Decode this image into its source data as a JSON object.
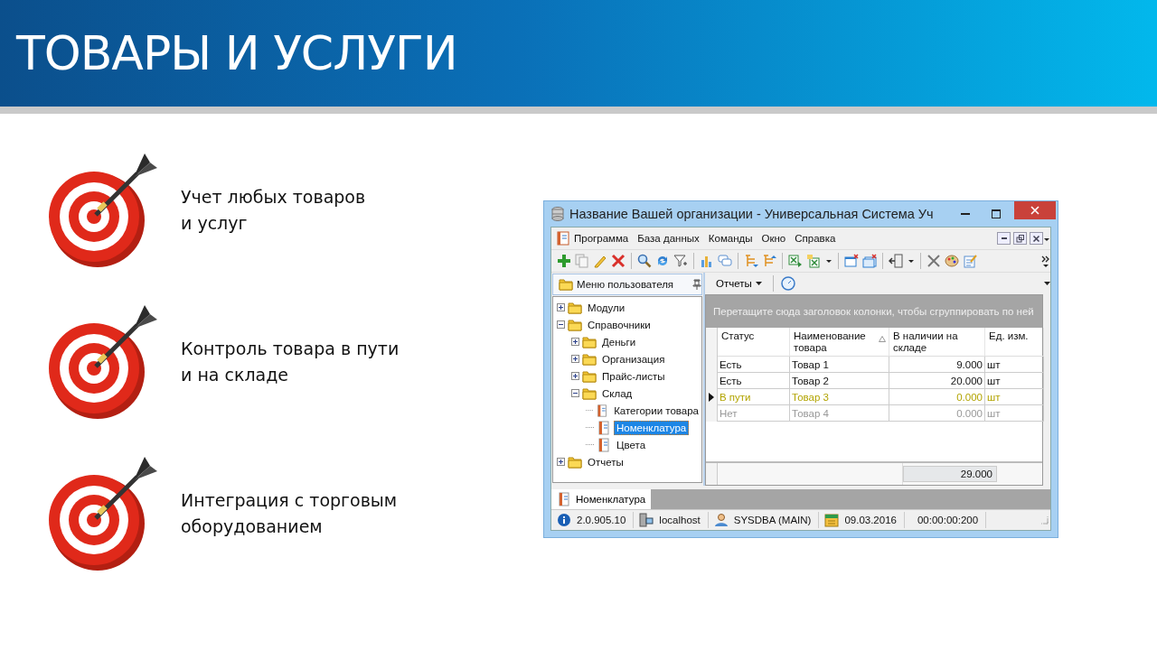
{
  "slide": {
    "title": "ТОВАРЫ И УСЛУГИ",
    "features": [
      {
        "text": "Учет любых товаров\nи услуг"
      },
      {
        "text": "Контроль товара в пути\nи на складе"
      },
      {
        "text": "Интеграция с торговым\nоборудованием"
      }
    ]
  },
  "window": {
    "title": "Название Вашей организации - Универсальная Система Уч",
    "menu": [
      "Программа",
      "База данных",
      "Команды",
      "Окно",
      "Справка"
    ],
    "nav_panel": {
      "title": "Меню пользователя",
      "tree": [
        {
          "label": "Модули",
          "kind": "folder",
          "expanded": false,
          "selected": false
        },
        {
          "label": "Справочники",
          "kind": "folder",
          "expanded": true,
          "selected": false,
          "children": [
            {
              "label": "Деньги",
              "kind": "folder",
              "expanded": false,
              "selected": false
            },
            {
              "label": "Организация",
              "kind": "folder",
              "expanded": false,
              "selected": false
            },
            {
              "label": "Прайс-листы",
              "kind": "folder",
              "expanded": false,
              "selected": false
            },
            {
              "label": "Склад",
              "kind": "folder",
              "expanded": true,
              "selected": false,
              "children": [
                {
                  "label": "Категории товара",
                  "kind": "document",
                  "selected": false
                },
                {
                  "label": "Номенклатура",
                  "kind": "document",
                  "selected": true
                },
                {
                  "label": "Цвета",
                  "kind": "document",
                  "selected": false
                }
              ]
            }
          ]
        },
        {
          "label": "Отчеты",
          "kind": "folder",
          "expanded": false,
          "selected": false
        }
      ]
    },
    "reports_button": "Отчеты",
    "grid": {
      "group_hint": "Перетащите сюда заголовок колонки, чтобы сгруппировать по ней",
      "columns": [
        {
          "label": "Статус",
          "sorted": false
        },
        {
          "label": "Наименование товара",
          "sorted": true
        },
        {
          "label": "В наличии на складе",
          "sorted": false
        },
        {
          "label": "Ед. изм.",
          "sorted": false
        }
      ],
      "rows": [
        {
          "kind": "in_stock",
          "selected": false,
          "cells": [
            "Есть",
            "Товар 1",
            "9.000",
            "шт"
          ]
        },
        {
          "kind": "in_stock",
          "selected": false,
          "cells": [
            "Есть",
            "Товар 2",
            "20.000",
            "шт"
          ]
        },
        {
          "kind": "in_transit",
          "selected": true,
          "cells": [
            "В пути",
            "Товар 3",
            "0.000",
            "шт"
          ]
        },
        {
          "kind": "absent",
          "selected": false,
          "cells": [
            "Нет",
            "Товар 4",
            "0.000",
            "шт"
          ]
        }
      ],
      "total": "29.000"
    },
    "tabs": [
      {
        "label": "Номенклатура",
        "selected": true
      }
    ],
    "status_bar": [
      {
        "kind": "version",
        "text": "2.0.905.10"
      },
      {
        "kind": "server",
        "text": "localhost"
      },
      {
        "kind": "user",
        "text": "SYSDBA (MAIN)"
      },
      {
        "kind": "date",
        "text": "09.03.2016"
      },
      {
        "kind": "timer",
        "text": "00:00:00:200"
      }
    ]
  }
}
